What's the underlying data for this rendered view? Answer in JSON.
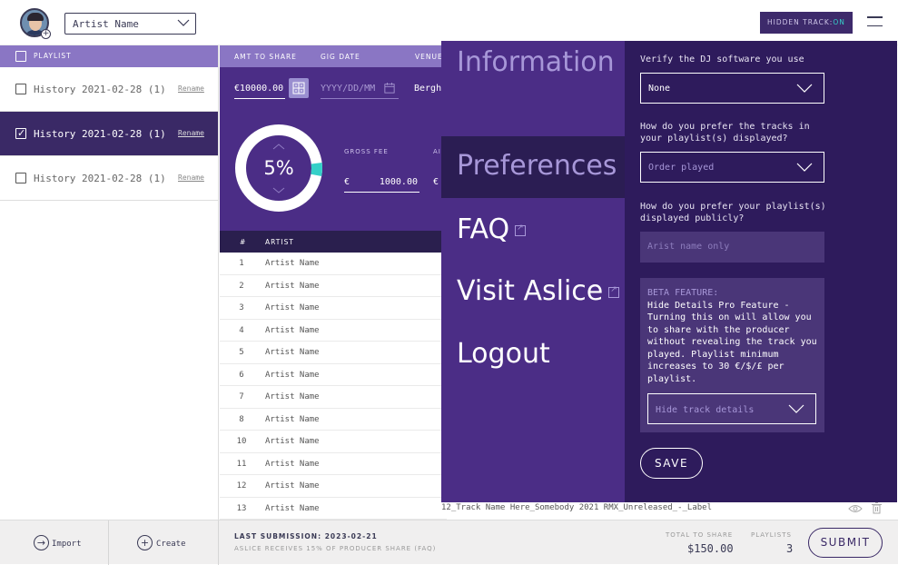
{
  "header": {
    "artist_select": "Artist Name",
    "hidden_track_label": "HIDDEN TRACK:",
    "hidden_track_state": "ON",
    "accent_color": "#35d0c8"
  },
  "playlist": {
    "header": "PLAYLIST",
    "rename_label": "Rename",
    "items": [
      {
        "name": "History 2021-02-28 (1)",
        "checked": false
      },
      {
        "name": "History 2021-02-28 (1)",
        "checked": true
      },
      {
        "name": "History 2021-02-28 (1)",
        "checked": false
      }
    ]
  },
  "share": {
    "columns": {
      "amt": "AMT TO SHARE",
      "date": "GIG DATE",
      "venue": "VENUE"
    },
    "amount": "€10000.00",
    "date_placeholder": "YYYY/DD/MM",
    "venue": "Bergh",
    "percent": "5%",
    "percent_value": 5,
    "gross_label": "GROSS FEE",
    "am_label": "AI",
    "currency": "€",
    "gross_value": "1000.00"
  },
  "tracks": {
    "columns": {
      "num": "#",
      "artist": "ARTIST"
    },
    "rows": [
      {
        "num": "1",
        "artist": "Artist Name"
      },
      {
        "num": "2",
        "artist": "Artist Name"
      },
      {
        "num": "3",
        "artist": "Artist Name"
      },
      {
        "num": "4",
        "artist": "Artist Name"
      },
      {
        "num": "5",
        "artist": "Artist Name"
      },
      {
        "num": "6",
        "artist": "Artist Name"
      },
      {
        "num": "7",
        "artist": "Artist Name"
      },
      {
        "num": "8",
        "artist": "Artist Name"
      },
      {
        "num": "10",
        "artist": "Artist Name"
      },
      {
        "num": "11",
        "artist": "Artist Name"
      },
      {
        "num": "12",
        "artist": "Artist Name"
      },
      {
        "num": "13",
        "artist": "Artist Name"
      }
    ],
    "overflow_track": "12_Track Name Here_Somebody 2021 RMX_Unreleased_-_Label"
  },
  "menu": {
    "information": "Information",
    "preferences": "Preferences",
    "faq": "FAQ",
    "visit": "Visit Aslice",
    "logout": "Logout"
  },
  "prefs": {
    "q1": "Verify the DJ software you use",
    "q1_value": "None",
    "q2": "How do you prefer the tracks in your playlist(s) displayed?",
    "q2_value": "Order played",
    "q3": "How do you prefer your playlist(s) displayed publicly?",
    "q3_value": "Arist name only",
    "beta_label": "BETA FEATURE:",
    "beta_text": "Hide Details Pro Feature - Turning this on will allow you to share with the producer without revealing the track you played. Playlist minimum increases to 30 €/$/£ per playlist.",
    "beta_value": "Hide track details",
    "save": "SAVE"
  },
  "footer": {
    "import": "Import",
    "create": "Create",
    "last_submission": "LAST SUBMISSION: 2023-02-21",
    "note": "ASLICE RECEIVES 15% OF PRODUCER SHARE (FAQ)",
    "total_label": "TOTAL TO SHARE",
    "total_value": "$150.00",
    "playlists_label": "PLAYLISTS",
    "playlists_value": "3",
    "submit": "SUBMIT"
  }
}
